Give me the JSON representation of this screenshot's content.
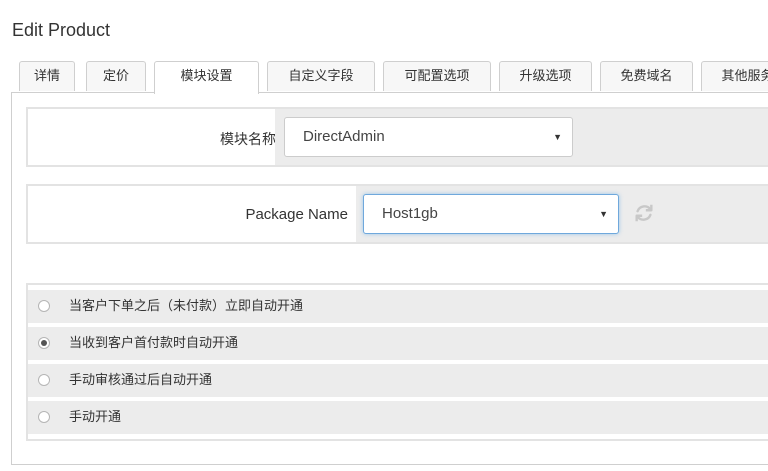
{
  "page": {
    "title": "Edit Product"
  },
  "tabs": [
    {
      "label": "详情",
      "active": false
    },
    {
      "label": "定价",
      "active": false
    },
    {
      "label": "模块设置",
      "active": true
    },
    {
      "label": "自定义字段",
      "active": false
    },
    {
      "label": "可配置选项",
      "active": false
    },
    {
      "label": "升级选项",
      "active": false
    },
    {
      "label": "免费域名",
      "active": false
    },
    {
      "label": "其他服务",
      "active": false
    }
  ],
  "module": {
    "label": "模块名称",
    "selected": "DirectAdmin"
  },
  "package": {
    "label": "Package Name",
    "selected": "Host1gb",
    "refresh_icon": "refresh-icon"
  },
  "provisioning": {
    "options": [
      {
        "label": "当客户下单之后（未付款）立即自动开通",
        "checked": false
      },
      {
        "label": "当收到客户首付款时自动开通",
        "checked": true
      },
      {
        "label": "手动审核通过后自动开通",
        "checked": false
      },
      {
        "label": "手动开通",
        "checked": false
      }
    ]
  },
  "colors": {
    "border": "#cfcfcf",
    "row_bg": "#ececec",
    "focus": "#6fa8dc"
  }
}
